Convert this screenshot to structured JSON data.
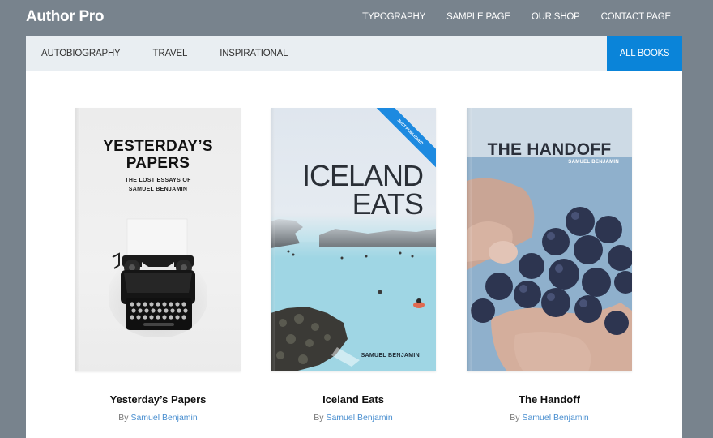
{
  "header": {
    "site_title": "Author Pro",
    "nav": [
      "TYPOGRAPHY",
      "SAMPLE PAGE",
      "OUR SHOP",
      "CONTACT PAGE"
    ]
  },
  "subnav": {
    "categories": [
      "AUTOBIOGRAPHY",
      "TRAVEL",
      "INSPIRATIONAL"
    ],
    "all_books_label": "ALL BOOKS",
    "accent_color": "#0a84d9"
  },
  "books": [
    {
      "title": "Yesterday’s Papers",
      "by": "By",
      "author": "Samuel Benjamin",
      "cover": {
        "title_lines": [
          "YESTERDAY’S",
          "PAPERS"
        ],
        "subtitle_lines": [
          "THE LOST ESSAYS OF",
          "SAMUEL BENJAMIN"
        ],
        "image": "typewriter"
      }
    },
    {
      "title": "Iceland Eats",
      "by": "By",
      "author": "Samuel Benjamin",
      "cover": {
        "title_lines": [
          "ICELAND",
          "EATS"
        ],
        "ribbon": "JUST PUBLISHED",
        "author": "SAMUEL BENJAMIN",
        "image": "blue-lagoon"
      }
    },
    {
      "title": "The Handoff",
      "by": "By",
      "author": "Samuel Benjamin",
      "cover": {
        "title_lines": [
          "THE HANDOFF"
        ],
        "author": "SAMUEL BENJAMIN",
        "image": "hand-with-grapes"
      }
    }
  ]
}
